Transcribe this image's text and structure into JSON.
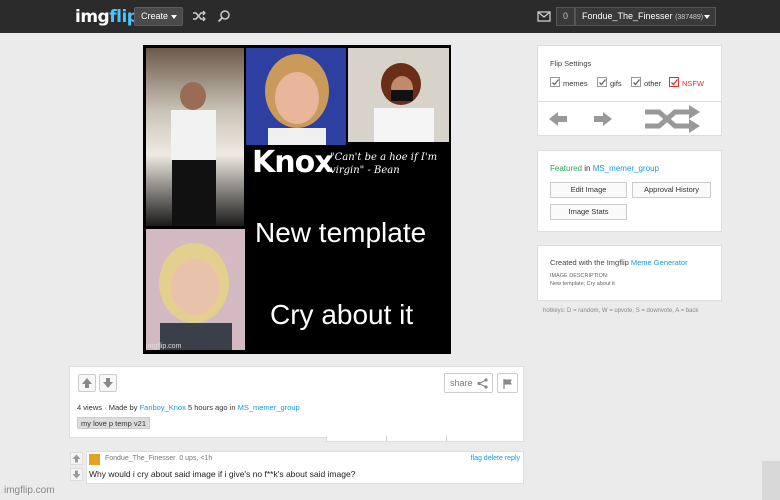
{
  "header": {
    "logo_img": "img",
    "logo_flip": "flip",
    "create_label": "Create",
    "notif_count": "0",
    "username": "Fondue_The_Finesser",
    "points": "(387489)"
  },
  "meme": {
    "name_text": "Knox",
    "quote_text": "\"Can't be a hoe if I'm virgin\" - Bean",
    "line1": "New template",
    "line2": "Cry about it",
    "watermark": "imgflip.com"
  },
  "post": {
    "share_label": "share",
    "views": "4 views",
    "made_by_prefix": "· Made by",
    "author": "Fanboy_Knox",
    "time_ago": "5 hours ago in",
    "stream": "MS_memer_group",
    "tag": "my love p temp v21"
  },
  "comment": {
    "user": "Fondue_The_Finesser",
    "meta": "0 ups, <1h",
    "actions": "flag delete reply",
    "text": "Why would i cry about said image if i give's no f**k's about said image?"
  },
  "flip_settings": {
    "title": "Flip Settings",
    "options": [
      {
        "label": "memes",
        "checked": true,
        "color": "#333333"
      },
      {
        "label": "gifs",
        "checked": true,
        "color": "#333333"
      },
      {
        "label": "other",
        "checked": true,
        "color": "#333333"
      },
      {
        "label": "NSFW",
        "checked": true,
        "color": "#e03030"
      }
    ]
  },
  "featured": {
    "prefix": "Featured",
    "in_word": "in",
    "stream": "MS_memer_group",
    "buttons": [
      "Edit Image",
      "Approval History",
      "Image Stats"
    ]
  },
  "created": {
    "prefix": "Created with the Imgflip",
    "link": "Meme Generator",
    "desc_label": "IMAGE DESCRIPTION:",
    "desc_value": "New template; Cry about it"
  },
  "hotkeys": "hotkeys: D = random, W = upvote, S = downvote, A = back",
  "footer_watermark": "imgflip.com",
  "colors": {
    "header_bg": "#2b2b2b",
    "accent": "#1a98d9",
    "nsfw": "#e03030",
    "page_bg": "#ebebeb"
  }
}
